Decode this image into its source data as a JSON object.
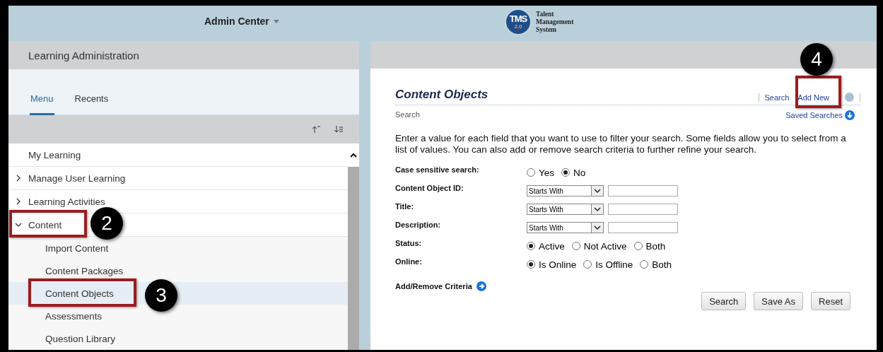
{
  "header": {
    "title": "Admin Center",
    "logo": {
      "badge": "TMS",
      "version": "2.0",
      "lines": [
        "Talent",
        "Management",
        "System"
      ]
    }
  },
  "sidebar": {
    "title": "Learning Administration",
    "tabs": [
      {
        "label": "Menu",
        "selected": true
      },
      {
        "label": "Recents",
        "selected": false
      }
    ],
    "items": [
      {
        "label": "My Learning",
        "kind": "leaf",
        "selected": false
      },
      {
        "label": "Manage User Learning",
        "kind": "folder",
        "expanded": false,
        "selected": false
      },
      {
        "label": "Learning Activities",
        "kind": "folder",
        "expanded": false,
        "selected": false
      },
      {
        "label": "Content",
        "kind": "folder",
        "expanded": true,
        "selected": false,
        "children": [
          {
            "label": "Import Content",
            "selected": false
          },
          {
            "label": "Content Packages",
            "selected": false
          },
          {
            "label": "Content Objects",
            "selected": true
          },
          {
            "label": "Assessments",
            "selected": false
          },
          {
            "label": "Question Library",
            "selected": false
          }
        ]
      }
    ]
  },
  "content": {
    "title": "Content Objects",
    "links": [
      "Search",
      "Add New"
    ],
    "subtitle": "Search",
    "saved_searches": "Saved Searches",
    "intro": "Enter a value for each field that you want to use to filter your search. Some fields allow you to select from a list of values. You can also add or remove search criteria to further refine your search.",
    "fields": [
      {
        "kind": "radio",
        "label": "Case sensitive search:",
        "options": [
          {
            "label": "Yes",
            "selected": false
          },
          {
            "label": "No",
            "selected": true
          }
        ]
      },
      {
        "kind": "text",
        "label": "Content Object ID:",
        "operator": "Starts With"
      },
      {
        "kind": "text",
        "label": "Title:",
        "operator": "Starts With"
      },
      {
        "kind": "text",
        "label": "Description:",
        "operator": "Starts With"
      },
      {
        "kind": "radio",
        "label": "Status:",
        "options": [
          {
            "label": "Active",
            "selected": true
          },
          {
            "label": "Not Active",
            "selected": false
          },
          {
            "label": "Both",
            "selected": false
          }
        ]
      },
      {
        "kind": "radio",
        "label": "Online:",
        "options": [
          {
            "label": "Is Online",
            "selected": true
          },
          {
            "label": "Is Offline",
            "selected": false
          },
          {
            "label": "Both",
            "selected": false
          }
        ]
      }
    ],
    "criteria_link": "Add/Remove Criteria",
    "buttons": [
      "Search",
      "Save As",
      "Reset"
    ]
  },
  "callouts": [
    {
      "number": "2"
    },
    {
      "number": "3"
    },
    {
      "number": "4"
    }
  ]
}
